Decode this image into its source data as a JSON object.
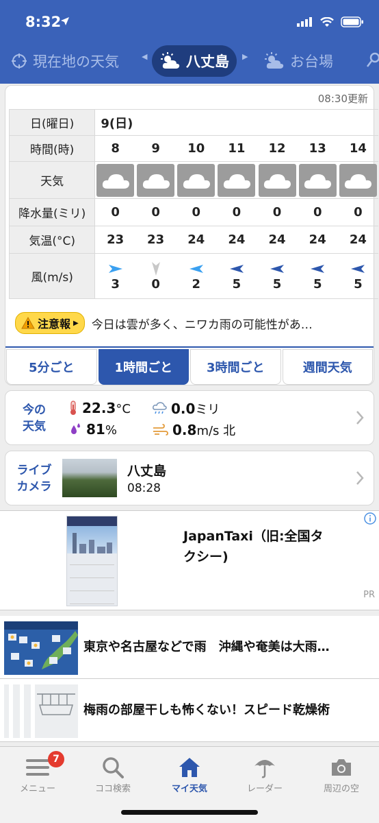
{
  "status": {
    "time": "8:32"
  },
  "locations": {
    "left": "現在地の天気",
    "active": "八丈島",
    "right": "お台場"
  },
  "forecast": {
    "updated": "08:30更新",
    "labels": {
      "day": "日(曜日)",
      "hour": "時間(時)",
      "weather": "天気",
      "precip": "降水量(ミリ)",
      "temp": "気温(°C)",
      "wind": "風(m/s)"
    },
    "day": "9(日)",
    "hours": [
      "8",
      "9",
      "10",
      "11",
      "12",
      "13",
      "14"
    ],
    "weather_icons": [
      "cloudy-icon",
      "cloudy-icon",
      "cloudy-icon",
      "cloudy-icon",
      "cloudy-icon",
      "cloudy-icon",
      "cloudy-icon"
    ],
    "precip": [
      "0",
      "0",
      "0",
      "0",
      "0",
      "0",
      "0"
    ],
    "temp": [
      "23",
      "23",
      "24",
      "24",
      "24",
      "24",
      "24"
    ],
    "wind_speed": [
      "3",
      "0",
      "2",
      "5",
      "5",
      "5",
      "5"
    ],
    "wind_arrows": [
      {
        "icon": "wind-arrow-icon",
        "color": "#3aa0f0",
        "dir": "right"
      },
      {
        "icon": "wind-arrow-icon",
        "color": "#c8c8c8",
        "dir": "down"
      },
      {
        "icon": "wind-arrow-icon",
        "color": "#3aa0f0",
        "dir": "left"
      },
      {
        "icon": "wind-arrow-icon",
        "color": "#2d57ad",
        "dir": "left"
      },
      {
        "icon": "wind-arrow-icon",
        "color": "#2d57ad",
        "dir": "left"
      },
      {
        "icon": "wind-arrow-icon",
        "color": "#2d57ad",
        "dir": "left"
      },
      {
        "icon": "wind-arrow-icon",
        "color": "#2d57ad",
        "dir": "left"
      }
    ]
  },
  "alert": {
    "badge": "注意報",
    "text": "今日は雲が多く、ニワカ雨の可能性があ…"
  },
  "view_tabs": [
    "5分ごと",
    "1時間ごと",
    "3時間ごと",
    "週間天気"
  ],
  "now": {
    "label_line1": "今の",
    "label_line2": "天気",
    "temp_value": "22.3",
    "temp_unit": "°C",
    "rain_value": "0.0",
    "rain_unit": "ミリ",
    "humidity_value": "81",
    "humidity_unit": "%",
    "wind_value": "0.8",
    "wind_unit": "m/s 北"
  },
  "live": {
    "label_line1": "ライブ",
    "label_line2": "カメラ",
    "name": "八丈島",
    "time": "08:28"
  },
  "ad": {
    "title": "JapanTaxi（旧:全国タクシー)",
    "pr": "PR"
  },
  "news": [
    {
      "title": "東京や名古屋などで雨　沖縄や奄美は大雨…"
    },
    {
      "title": "梅雨の部屋干しも怖くない！スピード乾燥術"
    }
  ],
  "tabbar": {
    "menu": "メニュー",
    "menu_badge": "7",
    "search": "ココ検索",
    "my_weather": "マイ天気",
    "radar": "レーダー",
    "sky": "周辺の空"
  },
  "colors": {
    "header_blue": "#3a62b9",
    "accent_blue": "#2d57ad",
    "alert_yellow": "#ffd84a",
    "badge_red": "#e43b2f"
  }
}
